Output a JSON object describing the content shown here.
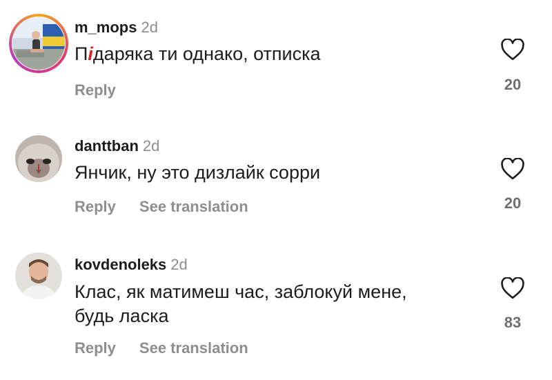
{
  "comments": [
    {
      "username": "m_mops",
      "time": "2d",
      "text_prefix": "П",
      "text_scribble": "і",
      "text_rest": "даряка ти однако, отписка",
      "reply": "Reply",
      "likes": "20",
      "avatar_icon": "profile-photo-person-outdoors",
      "has_story_ring": true
    },
    {
      "username": "danttban",
      "time": "2d",
      "text": "Янчик, ну это дизлайк сорри",
      "reply": "Reply",
      "translate": "See translation",
      "likes": "20",
      "avatar_icon": "profile-photo-cat"
    },
    {
      "username": "kovdenoleks",
      "time": "2d",
      "text": "Клас, як матимеш час, заблокуй мене, будь ласка",
      "reply": "Reply",
      "translate": "See translation",
      "likes": "83",
      "avatar_icon": "profile-photo-man"
    }
  ],
  "colors": {
    "muted": "#8e8e8e",
    "text": "#1c1c1c",
    "accent_scribble": "#d62020"
  }
}
